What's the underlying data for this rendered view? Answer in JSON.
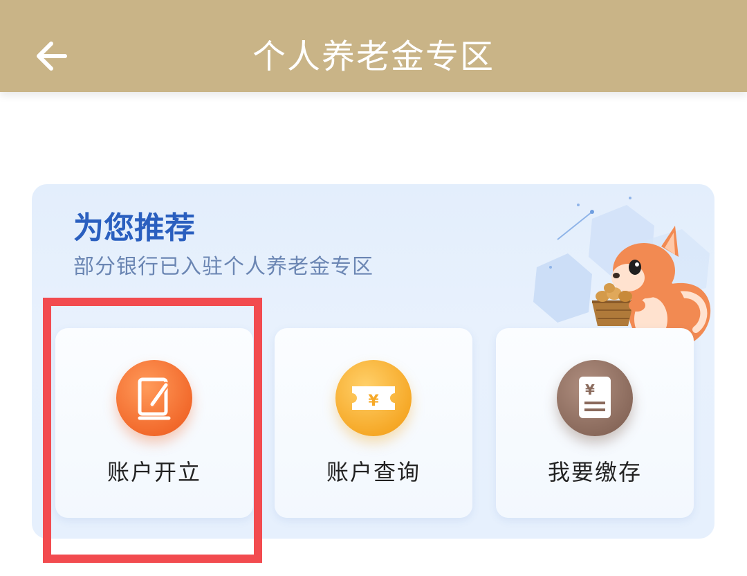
{
  "header": {
    "title": "个人养老金专区",
    "back_icon": "arrow-left-icon",
    "background": "#c9b487"
  },
  "recommend": {
    "title": "为您推荐",
    "subtitle": "部分银行已入驻个人养老金专区",
    "mascot": "squirrel-with-basket-illustration",
    "items": [
      {
        "label": "账户开立",
        "icon": "pen-paper-icon",
        "color": "#f26a2c"
      },
      {
        "label": "账户查询",
        "icon": "ticket-yuan-icon",
        "color": "#f6a928"
      },
      {
        "label": "我要缴存",
        "icon": "yuan-document-icon",
        "color": "#8a6a5c"
      }
    ]
  },
  "highlight_color": "#f24b4f"
}
